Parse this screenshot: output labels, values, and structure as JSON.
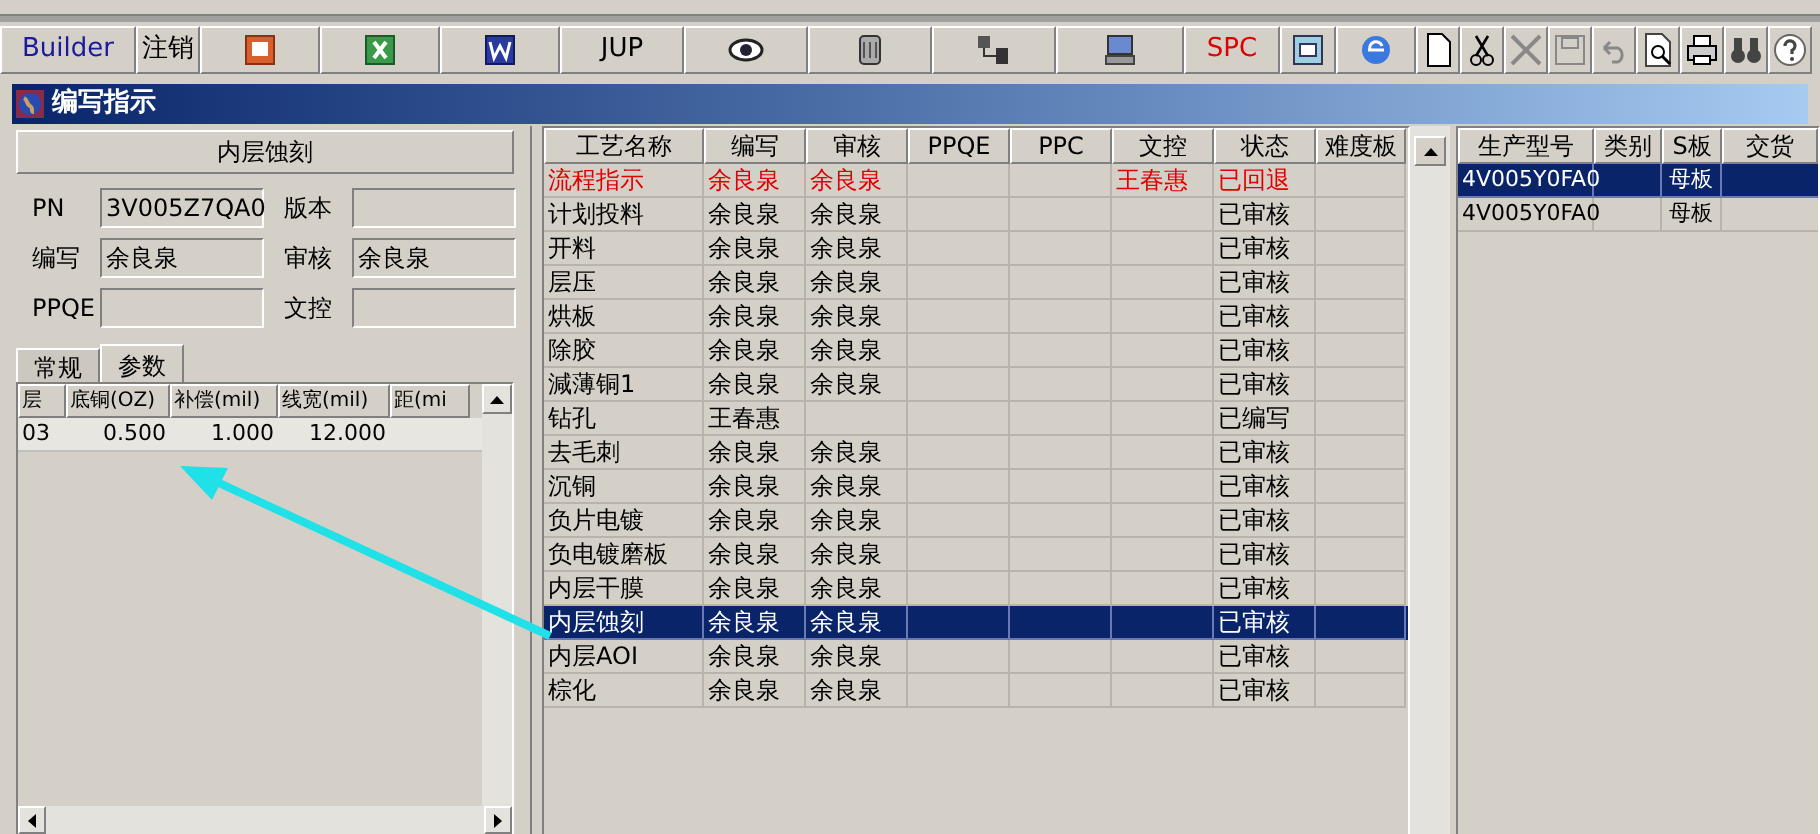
{
  "toolbar": [
    {
      "kind": "text",
      "label": "Builder",
      "color": "#1a1aa0"
    },
    {
      "kind": "text",
      "label": "注销",
      "color": "#000000"
    },
    {
      "kind": "ppt"
    },
    {
      "kind": "excel"
    },
    {
      "kind": "word"
    },
    {
      "kind": "text",
      "label": "JUP",
      "color": "#000000"
    },
    {
      "kind": "eye"
    },
    {
      "kind": "server"
    },
    {
      "kind": "network"
    },
    {
      "kind": "monitor"
    },
    {
      "kind": "text",
      "label": "SPC",
      "color": "#e00000"
    },
    {
      "kind": "app"
    },
    {
      "kind": "browser"
    },
    {
      "kind": "new"
    },
    {
      "kind": "cut"
    },
    {
      "kind": "delete"
    },
    {
      "kind": "save"
    },
    {
      "kind": "undo"
    },
    {
      "kind": "preview"
    },
    {
      "kind": "print"
    },
    {
      "kind": "find"
    },
    {
      "kind": "help"
    }
  ],
  "window": {
    "title": "编写指示"
  },
  "left_panel": {
    "heading": "内层蚀刻",
    "fields": [
      {
        "label": "PN",
        "value": "3V005Z7QA0"
      },
      {
        "label": "版本"
      },
      {
        "label": "编写",
        "value": "余良泉"
      },
      {
        "label": "审核",
        "value": "余良泉"
      },
      {
        "label": "PPQE"
      },
      {
        "label": "文控"
      }
    ],
    "tabs": [
      {
        "label": "常规",
        "selected": false
      },
      {
        "label": "参数",
        "selected": true
      }
    ],
    "grid": {
      "columns": [
        "层",
        "底铜(OZ)",
        "补偿(mil)",
        "线宽(mil)",
        "距(mi"
      ],
      "rows": [
        [
          "03",
          "0.500",
          "1.000",
          "12.000"
        ]
      ]
    }
  },
  "process_table": {
    "columns": [
      "工艺名称",
      "编写",
      "审核",
      "PPQE",
      "PPC",
      "文控",
      "状态",
      "难度板"
    ],
    "rows": [
      {
        "cells": [
          "流程指示",
          "余良泉",
          "余良泉",
          "",
          "",
          "王春惠",
          "已回退",
          ""
        ],
        "kind": "returned",
        "selected": false
      },
      {
        "cells": [
          "计划投料",
          "余良泉",
          "余良泉",
          "",
          "",
          "",
          "已审核",
          ""
        ],
        "kind": "normal",
        "selected": false
      },
      {
        "cells": [
          "开料",
          "余良泉",
          "余良泉",
          "",
          "",
          "",
          "已审核",
          ""
        ],
        "kind": "normal",
        "selected": false
      },
      {
        "cells": [
          "层压",
          "余良泉",
          "余良泉",
          "",
          "",
          "",
          "已审核",
          ""
        ],
        "kind": "normal",
        "selected": false
      },
      {
        "cells": [
          "烘板",
          "余良泉",
          "余良泉",
          "",
          "",
          "",
          "已审核",
          ""
        ],
        "kind": "normal",
        "selected": false
      },
      {
        "cells": [
          "除胶",
          "余良泉",
          "余良泉",
          "",
          "",
          "",
          "已审核",
          ""
        ],
        "kind": "normal",
        "selected": false
      },
      {
        "cells": [
          "減薄铜1",
          "余良泉",
          "余良泉",
          "",
          "",
          "",
          "已审核",
          ""
        ],
        "kind": "normal",
        "selected": false
      },
      {
        "cells": [
          "钻孔",
          "王春惠",
          "",
          "",
          "",
          "",
          "已编写",
          ""
        ],
        "kind": "normal",
        "selected": false
      },
      {
        "cells": [
          "去毛刺",
          "余良泉",
          "余良泉",
          "",
          "",
          "",
          "已审核",
          ""
        ],
        "kind": "normal",
        "selected": false
      },
      {
        "cells": [
          "沉铜",
          "余良泉",
          "余良泉",
          "",
          "",
          "",
          "已审核",
          ""
        ],
        "kind": "normal",
        "selected": false
      },
      {
        "cells": [
          "负片电镀",
          "余良泉",
          "余良泉",
          "",
          "",
          "",
          "已审核",
          ""
        ],
        "kind": "normal",
        "selected": false
      },
      {
        "cells": [
          "负电镀磨板",
          "余良泉",
          "余良泉",
          "",
          "",
          "",
          "已审核",
          ""
        ],
        "kind": "normal",
        "selected": false
      },
      {
        "cells": [
          "内层干膜",
          "余良泉",
          "余良泉",
          "",
          "",
          "",
          "已审核",
          ""
        ],
        "kind": "normal",
        "selected": false
      },
      {
        "cells": [
          "内层蚀刻",
          "余良泉",
          "余良泉",
          "",
          "",
          "",
          "已审核",
          ""
        ],
        "kind": "normal",
        "selected": true
      },
      {
        "cells": [
          "内层AOI",
          "余良泉",
          "余良泉",
          "",
          "",
          "",
          "已审核",
          ""
        ],
        "kind": "normal",
        "selected": false
      },
      {
        "cells": [
          "棕化",
          "余良泉",
          "余良泉",
          "",
          "",
          "",
          "已审核",
          ""
        ],
        "kind": "normal",
        "selected": false
      }
    ]
  },
  "model_table": {
    "columns": [
      "生产型号",
      "类别",
      "S板",
      "交货"
    ],
    "rows": [
      {
        "cells": [
          "4V005Y0FA0",
          "",
          "母板",
          ""
        ],
        "selected": true
      },
      {
        "cells": [
          "4V005Y0FA0",
          "",
          "母板",
          ""
        ],
        "selected": false
      }
    ]
  }
}
